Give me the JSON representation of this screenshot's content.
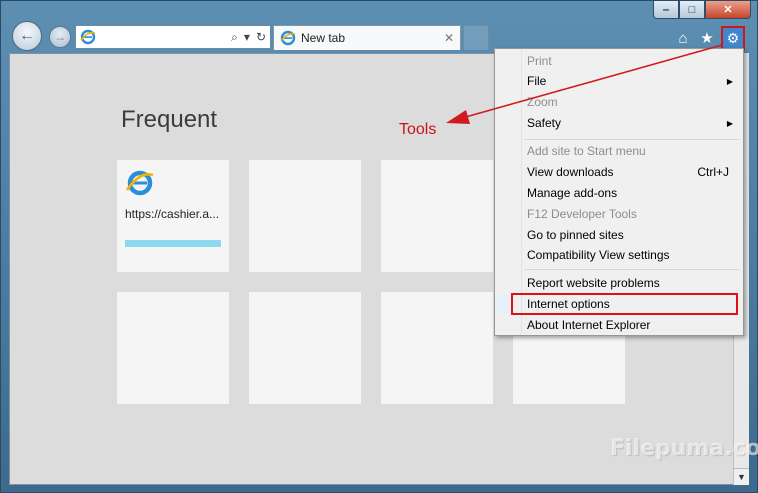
{
  "window": {
    "caption": {
      "minimize": "‒",
      "maximize": "□",
      "close": "✕"
    }
  },
  "nav": {
    "back_icon": "arrow-left-icon",
    "forward_icon": "arrow-right-icon",
    "address_value": "",
    "search_icon": "⌕",
    "dropdown_icon": "▾",
    "refresh_icon": "↻"
  },
  "tab": {
    "label": "New tab",
    "close": "✕"
  },
  "toolbar": {
    "home_icon": "⌂",
    "favorites_icon": "★",
    "tools_icon": "⚙"
  },
  "content": {
    "heading": "Frequent",
    "tiles": [
      {
        "url": "https://cashier.a...",
        "progress": 1.0
      }
    ]
  },
  "menu": {
    "items": [
      {
        "label": "Print",
        "disabled": true
      },
      {
        "label": "File",
        "submenu": true
      },
      {
        "label": "Zoom",
        "disabled": true
      },
      {
        "label": "Safety",
        "submenu": true
      },
      {
        "label": "Add site to Start menu",
        "disabled": true
      },
      {
        "label": "View downloads",
        "shortcut": "Ctrl+J"
      },
      {
        "label": "Manage add-ons"
      },
      {
        "label": "F12 Developer Tools",
        "disabled": true
      },
      {
        "label": "Go to pinned sites"
      },
      {
        "label": "Compatibility View settings"
      },
      {
        "label": "Report website problems"
      },
      {
        "label": "Internet options",
        "highlighted": true
      },
      {
        "label": "About Internet Explorer"
      }
    ],
    "submenu_arrow": "▶"
  },
  "annotation": {
    "label": "Tools",
    "color": "#c9141b"
  },
  "watermark": "Filepuma.com",
  "scrollbar": {
    "down_arrow": "▼"
  }
}
